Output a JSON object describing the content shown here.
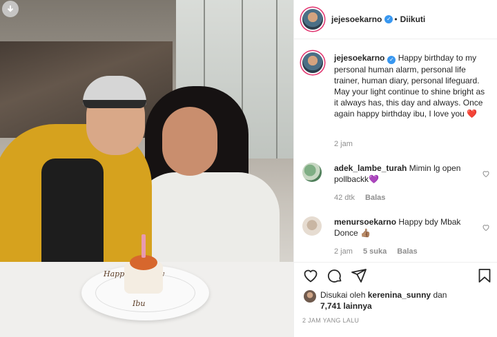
{
  "post": {
    "author": "jejesoekarno",
    "follow_status": "Diikuti",
    "caption": "Happy birthday to my personal human alarm, personal life trainer, human diary, personal lifeguard. May your light continue to shine bright as it always has, this day and always. Once again happy birthday ibu, I love you",
    "caption_emoji": "❤️",
    "caption_time": "2 jam",
    "photo_plate_text_1": "Happy Birthday",
    "photo_plate_text_2": "Ibu"
  },
  "comments": [
    {
      "user": "adek_lambe_turah",
      "text": "Mimin lg open pollbackk",
      "emoji": "💜",
      "time": "42 dtk",
      "reply": "Balas"
    },
    {
      "user": "menursoekarno",
      "text": "Happy bdy Mbak Donce",
      "emoji": "👍🏽",
      "time": "2 jam",
      "likes": "5 suka",
      "reply": "Balas"
    }
  ],
  "likes": {
    "prefix": "Disukai oleh",
    "user": "kerenina_sunny",
    "joiner": "dan",
    "count": "7,741 lainnya"
  },
  "timestamp": "2 JAM YANG LALU",
  "colors": {
    "verified": "#3897f0",
    "story_ring": "#e1306c",
    "muted": "#8e8e8e"
  },
  "icons": [
    "download-icon",
    "verified-icon",
    "heart-icon",
    "comment-icon",
    "share-icon",
    "bookmark-icon"
  ]
}
